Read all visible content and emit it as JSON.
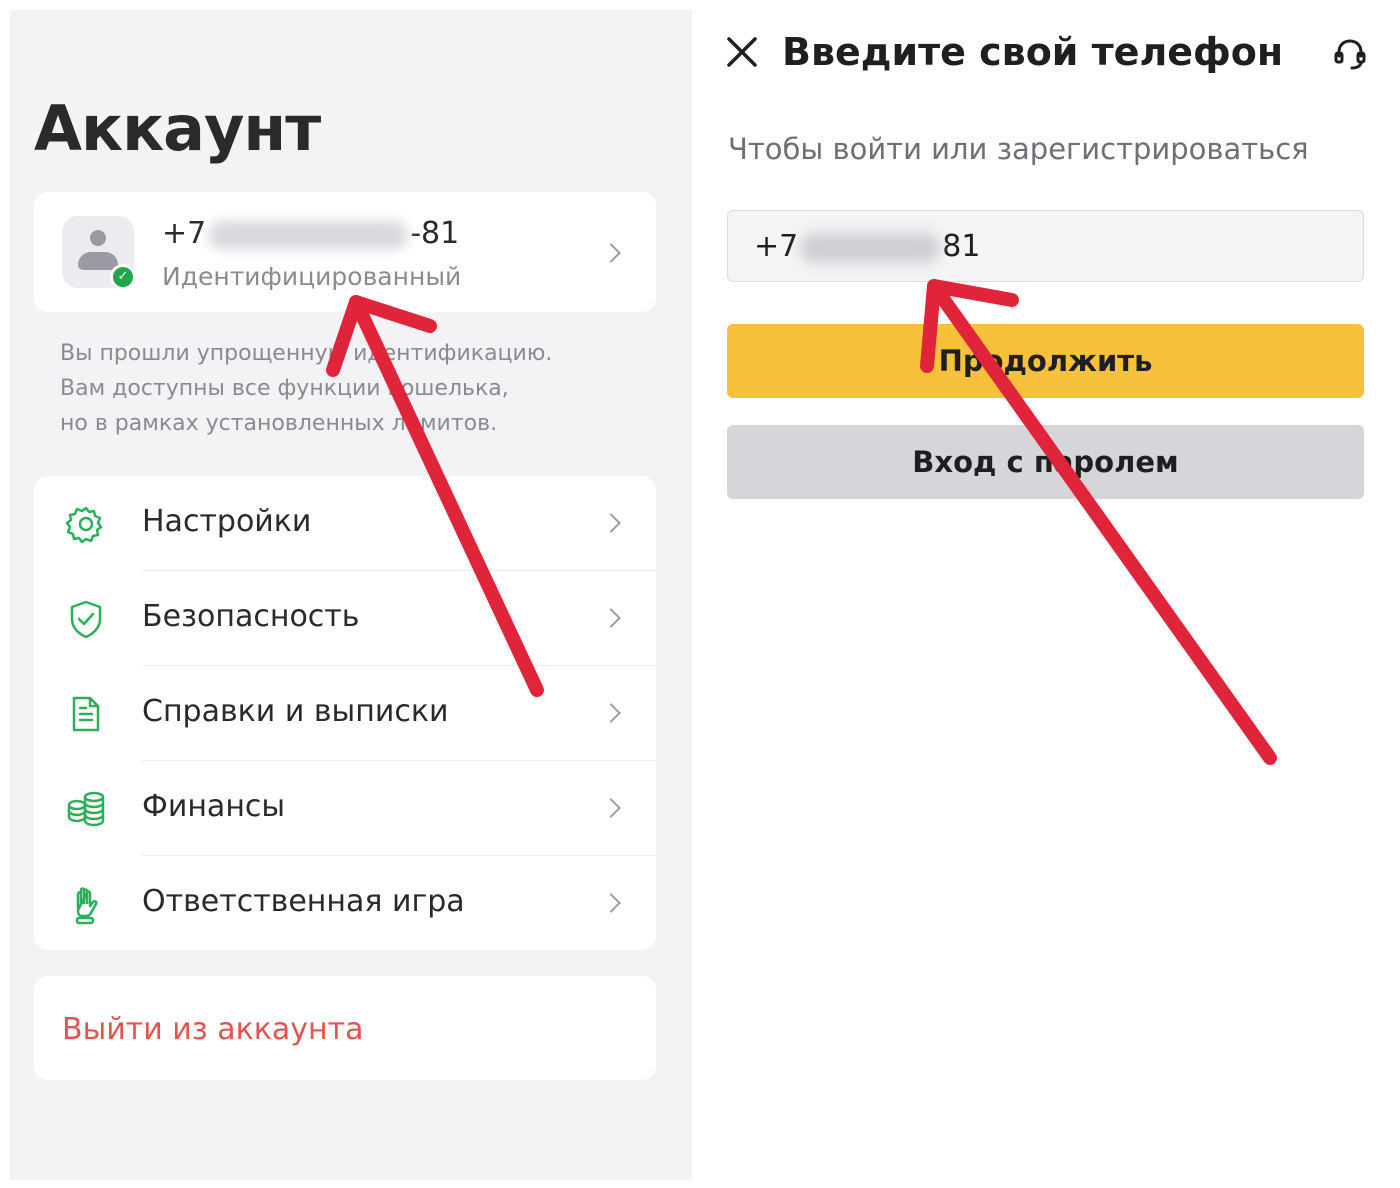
{
  "left": {
    "title": "Аккаунт",
    "profile": {
      "phone_prefix": "+7",
      "phone_suffix": "-81",
      "status": "Идентифицированный"
    },
    "note": {
      "line1": "Вы прошли упрощенную идентификацию.",
      "line2": "Вам доступны все функции кошелька,",
      "line3": "но в рамках установленных лимитов."
    },
    "menu": [
      {
        "label": "Настройки",
        "icon": "gear-icon"
      },
      {
        "label": "Безопасность",
        "icon": "shield-check-icon"
      },
      {
        "label": "Справки и выписки",
        "icon": "document-icon"
      },
      {
        "label": "Финансы",
        "icon": "coins-icon"
      },
      {
        "label": "Ответственная игра",
        "icon": "hand-icon"
      }
    ],
    "logout_label": "Выйти из аккаунта"
  },
  "right": {
    "title": "Введите свой телефон",
    "subtitle": "Чтобы войти или зарегистрироваться",
    "phone_prefix": "+7",
    "phone_suffix": "81",
    "continue_label": "Продолжить",
    "password_login_label": "Вход с паролем"
  },
  "colors": {
    "accent_green": "#22a64a",
    "continue_yellow": "#f8c13b",
    "logout_red": "#e0554d",
    "annotation_arrow": "#e0243a"
  }
}
